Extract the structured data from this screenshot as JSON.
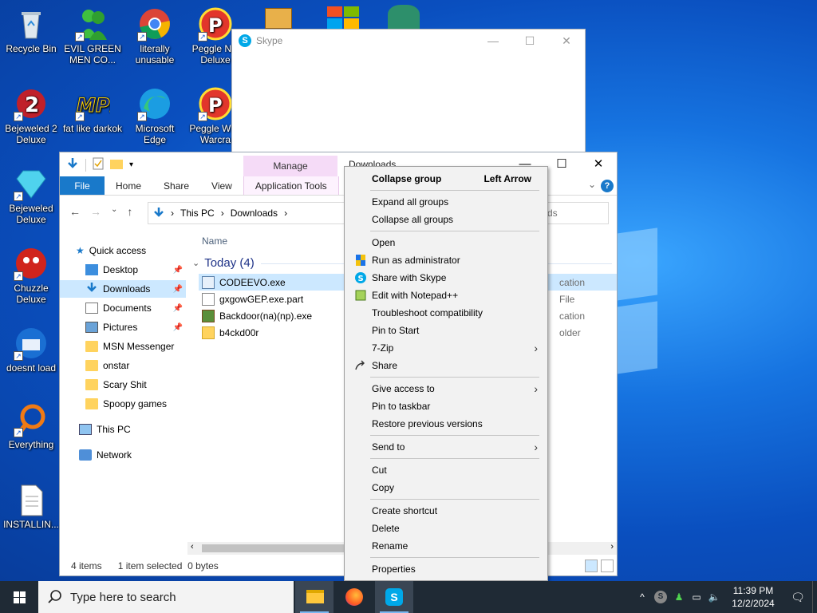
{
  "desktop": {
    "icons": [
      {
        "label": "Recycle Bin",
        "icon": "recycle-bin-icon"
      },
      {
        "label": "EVIL GREEN MEN CO...",
        "icon": "green-men-icon"
      },
      {
        "label": "literally unusable",
        "icon": "chrome-icon"
      },
      {
        "label": "Peggle Nig Deluxe",
        "icon": "peggle-icon"
      },
      {
        "label": "Bejeweled 2 Deluxe",
        "icon": "bejeweled-icon"
      },
      {
        "label": "fat like darkok",
        "icon": "mpi-icon"
      },
      {
        "label": "Microsoft Edge",
        "icon": "edge-icon"
      },
      {
        "label": "Peggle W of Warcra",
        "icon": "peggle-wow-icon"
      },
      {
        "label": "Bejeweled Deluxe",
        "icon": "diamond-icon"
      },
      {
        "label": "Chuzzle Deluxe",
        "icon": "chuzzle-icon"
      },
      {
        "label": "doesnt load",
        "icon": "thunderbird-icon"
      },
      {
        "label": "Everything",
        "icon": "search-everything-icon"
      },
      {
        "label": "INSTALLIN...",
        "icon": "text-file-icon"
      }
    ]
  },
  "skype_window": {
    "title": "Skype",
    "controls": [
      "—",
      "☐",
      "✕"
    ]
  },
  "explorer": {
    "manage_tab": "Manage",
    "title": "Downloads",
    "controls": [
      "—",
      "☐",
      "✕"
    ],
    "ribbon_tabs": [
      "File",
      "Home",
      "Share",
      "View",
      "Application Tools"
    ],
    "breadcrumb": [
      "This PC",
      "Downloads"
    ],
    "search_placeholder": "ds",
    "nav_pane": {
      "quick_access": "Quick access",
      "items": [
        {
          "label": "Desktop",
          "pinned": true
        },
        {
          "label": "Downloads",
          "pinned": true,
          "selected": true
        },
        {
          "label": "Documents",
          "pinned": true
        },
        {
          "label": "Pictures",
          "pinned": true
        },
        {
          "label": "MSN Messenger"
        },
        {
          "label": "onstar"
        },
        {
          "label": "Scary Shit"
        },
        {
          "label": "Spoopy games"
        }
      ],
      "this_pc": "This PC",
      "network": "Network"
    },
    "column_header": "Name",
    "group_label": "Today (4)",
    "files": [
      {
        "name": "CODEEVO.exe",
        "type": "cation",
        "selected": true
      },
      {
        "name": "gxgowGEP.exe.part",
        "type": "File"
      },
      {
        "name": "Backdoor(na)(np).exe",
        "type": "cation"
      },
      {
        "name": "b4ckd00r",
        "type": "older"
      }
    ],
    "status": {
      "items": "4 items",
      "selected": "1 item selected",
      "size": "0 bytes"
    }
  },
  "context_menu": {
    "collapse_group": "Collapse group",
    "collapse_shortcut": "Left Arrow",
    "expand_all": "Expand all groups",
    "collapse_all": "Collapse all groups",
    "open": "Open",
    "run_admin": "Run as administrator",
    "share_skype": "Share with Skype",
    "edit_notepad": "Edit with Notepad++",
    "troubleshoot": "Troubleshoot compatibility",
    "pin_start": "Pin to Start",
    "seven_zip": "7-Zip",
    "share": "Share",
    "give_access": "Give access to",
    "pin_taskbar": "Pin to taskbar",
    "restore_prev": "Restore previous versions",
    "send_to": "Send to",
    "cut": "Cut",
    "copy": "Copy",
    "create_shortcut": "Create shortcut",
    "delete": "Delete",
    "rename": "Rename",
    "properties": "Properties"
  },
  "taskbar": {
    "search_placeholder": "Type here to search",
    "time": "11:39 PM",
    "date": "12/2/2024"
  }
}
